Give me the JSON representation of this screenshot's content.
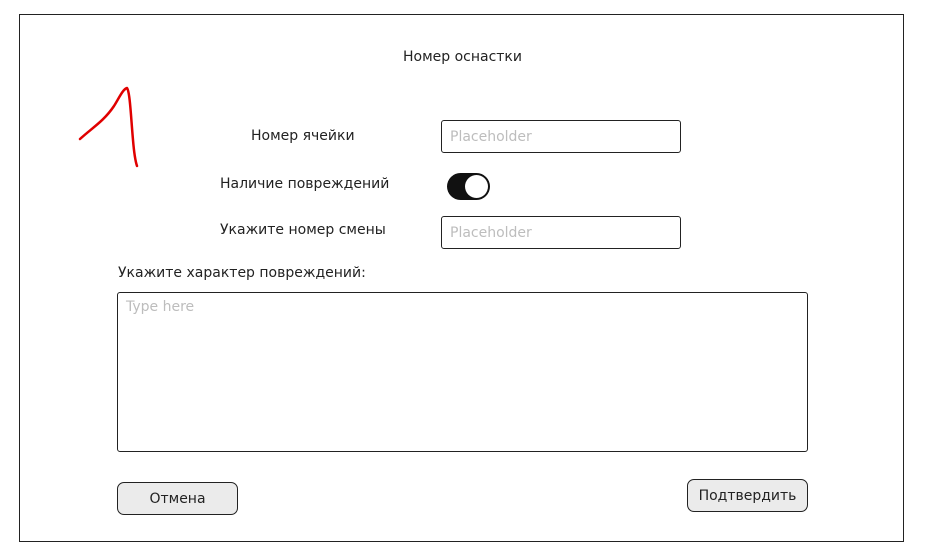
{
  "form": {
    "title": "Номер оснастки",
    "cell_number": {
      "label": "Номер ячейки",
      "placeholder": "Placeholder",
      "value": ""
    },
    "damage_present": {
      "label": "Наличие повреждений",
      "checked": true
    },
    "shift_number": {
      "label": "Укажите номер смены",
      "placeholder": "Placeholder",
      "value": ""
    },
    "damage_description": {
      "label": "Укажите характер повреждений:",
      "placeholder": "Type here",
      "value": ""
    },
    "cancel_label": "Отмена",
    "confirm_label": "Подтвердить"
  },
  "annotation": {
    "text": "1",
    "color": "#e00000"
  }
}
